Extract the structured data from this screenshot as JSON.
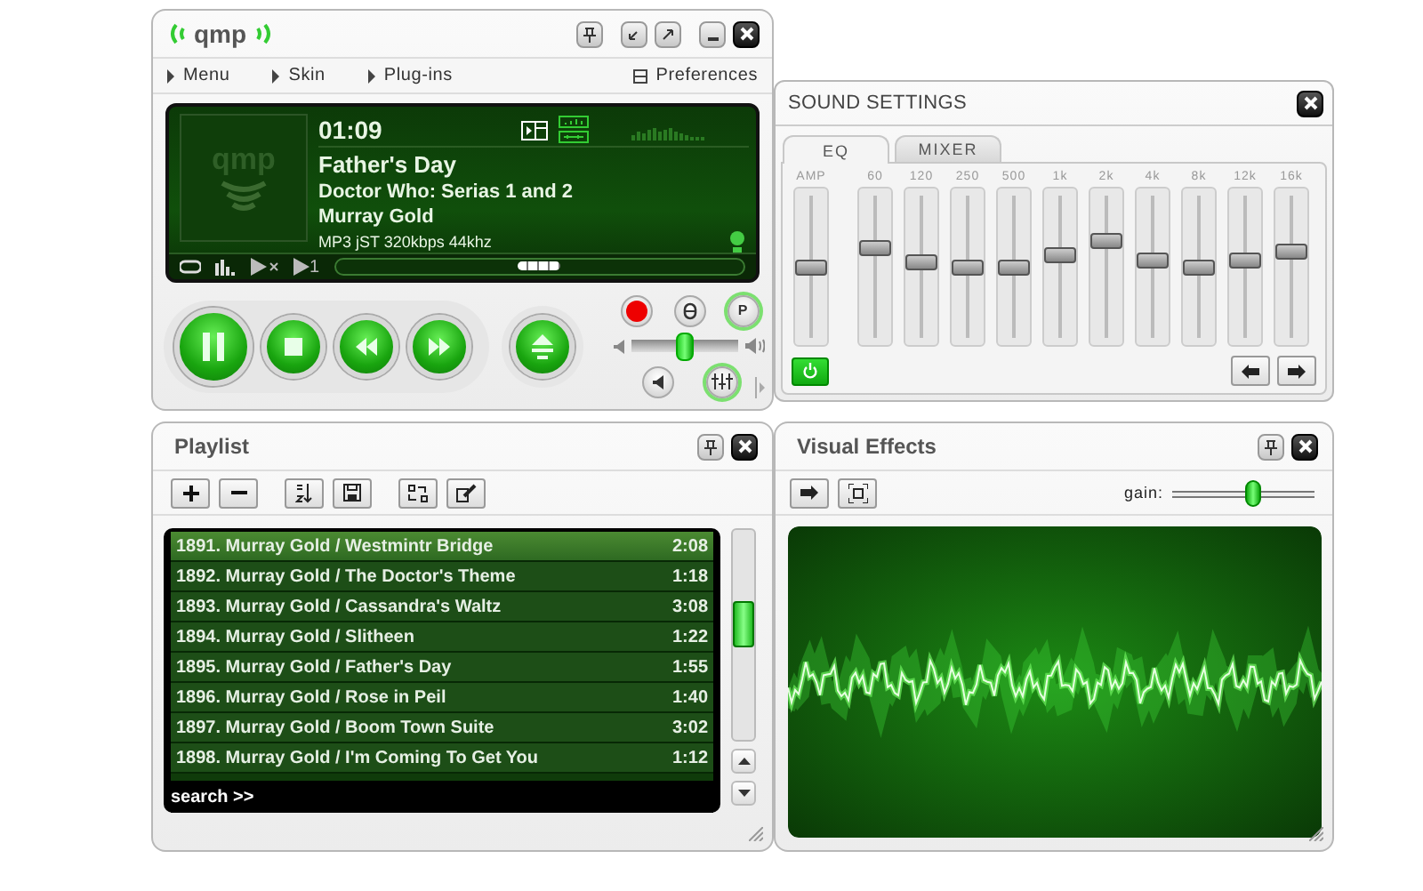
{
  "player": {
    "logo": "qmp",
    "menu": [
      {
        "label": "Menu"
      },
      {
        "label": "Skin"
      },
      {
        "label": "Plug-ins"
      }
    ],
    "preferences": "Preferences",
    "art_logo": "qmp",
    "time": "01:09",
    "title": "Father's Day",
    "album": "Doctor Who: Serias 1 and 2",
    "artist": "Murray Gold",
    "format": "MP3 jST 320kbps 44khz",
    "play_once_label": "1",
    "position": {
      "level": 0.5
    },
    "volume": {
      "level": 0.5
    },
    "p_button": {
      "label": "P",
      "on": true
    },
    "eq_button": {
      "on": true
    }
  },
  "sound_settings": {
    "title": "SOUND SETTINGS",
    "tabs": [
      {
        "label": "EQ",
        "selected": true
      },
      {
        "label": "MIXER",
        "selected": false
      }
    ],
    "bands": [
      {
        "label": "AMP",
        "level": 0.5
      },
      {
        "label": "60",
        "level": 0.64
      },
      {
        "label": "120",
        "level": 0.54
      },
      {
        "label": "250",
        "level": 0.5
      },
      {
        "label": "500",
        "level": 0.5
      },
      {
        "label": "1k",
        "level": 0.59
      },
      {
        "label": "2k",
        "level": 0.69
      },
      {
        "label": "4k",
        "level": 0.55
      },
      {
        "label": "8k",
        "level": 0.5
      },
      {
        "label": "12k",
        "level": 0.55
      },
      {
        "label": "16k",
        "level": 0.62
      }
    ],
    "power": {
      "on": true
    }
  },
  "playlist": {
    "title": "Playlist",
    "rows": [
      {
        "track": "1891. Murray Gold / Westmintr Bridge",
        "duration": "2:08",
        "selected": true
      },
      {
        "track": "1892. Murray Gold / The Doctor's Theme",
        "duration": "1:18",
        "selected": false
      },
      {
        "track": "1893. Murray Gold / Cassandra's Waltz",
        "duration": "3:08",
        "selected": false
      },
      {
        "track": "1894. Murray Gold / Slitheen",
        "duration": "1:22",
        "selected": false
      },
      {
        "track": "1895. Murray Gold / Father's Day",
        "duration": "1:55",
        "selected": false
      },
      {
        "track": "1896. Murray Gold / Rose in Peil",
        "duration": "1:40",
        "selected": false
      },
      {
        "track": "1897. Murray Gold / Boom Town Suite",
        "duration": "3:02",
        "selected": false
      },
      {
        "track": "1898. Murray Gold / I'm Coming To Get You",
        "duration": "1:12",
        "selected": false
      }
    ],
    "search": "search >>"
  },
  "visual_effects": {
    "title": "Visual Effects",
    "gain_label": "gain:",
    "gain": {
      "level": 0.58
    }
  }
}
